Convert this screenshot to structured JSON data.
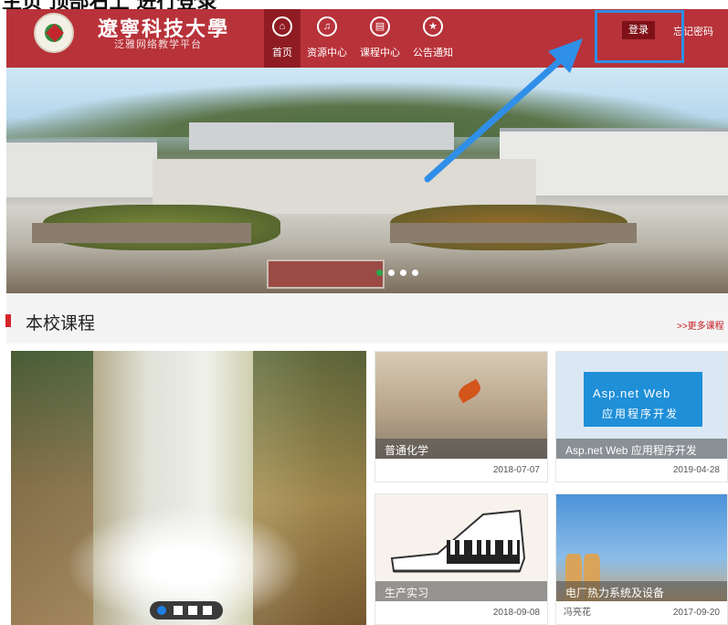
{
  "header": {
    "brand_title": "遼寧科技大學",
    "brand_subtitle": "泛雅网络教学平台",
    "nav": [
      {
        "label": "首页",
        "icon": "home-icon"
      },
      {
        "label": "资源中心",
        "icon": "bell-icon"
      },
      {
        "label": "课程中心",
        "icon": "book-icon"
      },
      {
        "label": "公告通知",
        "icon": "star-icon"
      }
    ],
    "login_label": "登录",
    "forgot_label": "忘记密码"
  },
  "section": {
    "title": "本校课程",
    "more_label": ">>更多课程"
  },
  "courses": [
    {
      "name": "普通化学",
      "date": "2018-07-07",
      "author": ""
    },
    {
      "name": "Asp.net Web 应用程序开发",
      "date": "2019-04-28",
      "author": "",
      "banner_line1": "Asp.net Web",
      "banner_line2": "应用程序开发"
    },
    {
      "name": "生产实习",
      "date": "2018-09-08",
      "author": ""
    },
    {
      "name": "电厂热力系统及设备",
      "date": "2017-09-20",
      "author": "冯亮花"
    }
  ],
  "colors": {
    "header_bg": "#b8323a",
    "login_bg": "#7e1117",
    "highlight": "#2f8fe8",
    "accent_red": "#d6242c"
  }
}
